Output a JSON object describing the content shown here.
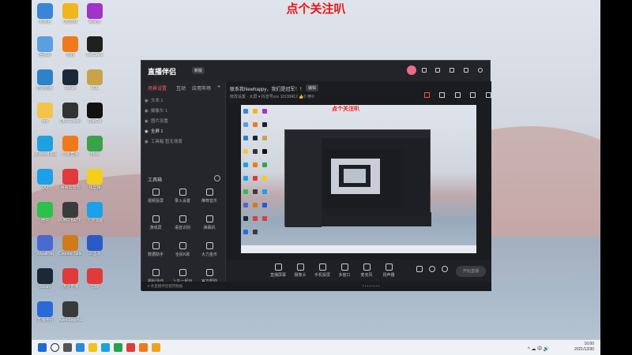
{
  "overlay": {
    "title": "点个关注叭"
  },
  "desktop": {
    "icons": [
      {
        "label": "此电脑",
        "color": "#3a86d6"
      },
      {
        "label": "QQ游戏",
        "color": "#f2b51c"
      },
      {
        "label": "网易云",
        "color": "#a033c8"
      },
      {
        "label": "回收站",
        "color": "#5aa0e0"
      },
      {
        "label": "猎豹",
        "color": "#f07a1a"
      },
      {
        "label": "WeGame",
        "color": "#202020"
      },
      {
        "label": "控制面板",
        "color": "#2c83c9"
      },
      {
        "label": "Steam",
        "color": "#1b2838"
      },
      {
        "label": "LOL",
        "color": "#c8a34a"
      },
      {
        "label": "obs",
        "color": "#f4c34a"
      },
      {
        "label": "OBS Studio",
        "color": "#333"
      },
      {
        "label": "CapCut",
        "color": "#111"
      },
      {
        "label": "Microsoft Edge",
        "color": "#1ea1e0"
      },
      {
        "label": "斗鱼直播",
        "color": "#f07a1a"
      },
      {
        "label": "Xbox",
        "color": "#3aa24a"
      },
      {
        "label": "QQ",
        "color": "#1aa1e9"
      },
      {
        "label": "网易云音乐",
        "color": "#e03a3a"
      },
      {
        "label": "快剪辑",
        "color": "#f2d01a"
      },
      {
        "label": "微信",
        "color": "#2ac24a"
      },
      {
        "label": "PUBG BATTLEGR..",
        "color": "#3b3b3b"
      },
      {
        "label": "迅游加速",
        "color": "#1aa1e9"
      },
      {
        "label": "VirtualPlay",
        "color": "#4a6ad0"
      },
      {
        "label": "Counter-Strike Global Off..",
        "color": "#d07a1a"
      },
      {
        "label": "三国杀",
        "color": "#2a5ac8"
      },
      {
        "label": "Steam",
        "color": "#1b2838"
      },
      {
        "label": "虎牙直播",
        "color": "#e03a3a"
      },
      {
        "label": "剪映",
        "color": "#e03a3a"
      },
      {
        "label": "直播伴侣",
        "color": "#2a6ad8"
      },
      {
        "label": "Apex Legends",
        "color": "#3a3a3a"
      }
    ]
  },
  "app": {
    "logo": "直播伴侣",
    "version": "新版",
    "left_tabs": [
      "场景设置",
      "互动",
      "应用市场"
    ],
    "scenes": [
      "文本 1",
      "摄像头 1",
      "图片设置",
      "全屏 1",
      "工具箱 暂无场景"
    ],
    "toolbox_title": "工具箱",
    "tools": [
      "视频投屏",
      "录入设置",
      "推荐音乐",
      "游戏屏",
      "语音识别",
      "弹幕机",
      "数据助手",
      "全民K歌",
      "大力金币",
      "福利活动",
      "上车一起玩",
      "官方帮助"
    ],
    "stream_title": "联系我Newhappy，我们是冠军！！",
    "edit_label": "编辑",
    "info_row": "修改设置 · 大屏 ▾    抖音号xxx  10193412    👍0    👁0",
    "controls": [
      "直播屏幕",
      "摄像头",
      "手机投屏",
      "多窗口",
      "麦克风",
      "扬声器"
    ],
    "start_live": "开始直播",
    "status_text": "0 条直播伴侣使用数据"
  },
  "preview": {
    "title": "点个关注叭"
  },
  "taskbar": {
    "time": "16:00",
    "date": "2021/12/30"
  }
}
